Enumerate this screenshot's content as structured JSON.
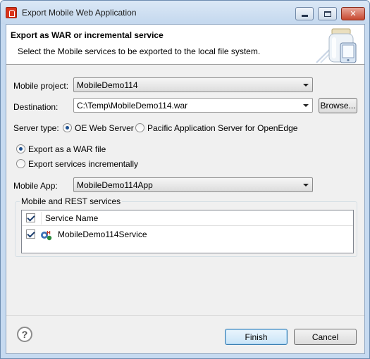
{
  "window": {
    "title": "Export Mobile Web Application",
    "controls": {
      "minimize_icon": "minimize-icon",
      "maximize_icon": "maximize-icon",
      "close_label": "✕"
    }
  },
  "banner": {
    "title": "Export as WAR or incremental service",
    "description": "Select the Mobile services to be exported to the local file system.",
    "icon": "mobile-jar-icon"
  },
  "form": {
    "mobile_project": {
      "label": "Mobile project:",
      "value": "MobileDemo114"
    },
    "destination": {
      "label": "Destination:",
      "value": "C:\\Temp\\MobileDemo114.war",
      "browse_label": "Browse..."
    },
    "server_type": {
      "label": "Server type:",
      "options": [
        {
          "label": "OE Web Server",
          "checked": true
        },
        {
          "label": "Pacific Application Server for OpenEdge",
          "checked": false
        }
      ]
    },
    "export_mode": {
      "options": [
        {
          "label": "Export as a WAR file",
          "checked": true
        },
        {
          "label": "Export services incrementally",
          "checked": false
        }
      ]
    },
    "mobile_app": {
      "label": "Mobile App:",
      "value": "MobileDemo114App"
    }
  },
  "services": {
    "group_title": "Mobile and REST services",
    "column_header": "Service Name",
    "header_checked": true,
    "rows": [
      {
        "name": "MobileDemo114Service",
        "checked": true,
        "icon": "rest-service-icon"
      }
    ]
  },
  "footer": {
    "help_icon": "help-icon",
    "finish_label": "Finish",
    "cancel_label": "Cancel"
  },
  "colors": {
    "title_bar": "#c4d8ee",
    "dialog_bg": "#f0f0f0",
    "close_button": "#c7482f",
    "accent": "#1d4f8f"
  }
}
